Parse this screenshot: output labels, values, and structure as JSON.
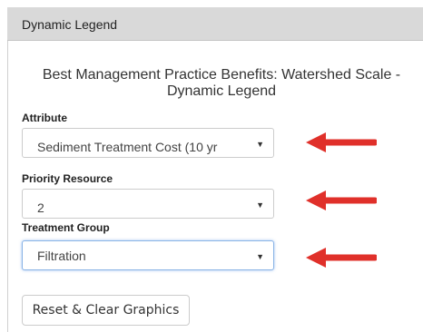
{
  "panel": {
    "title": "Dynamic Legend"
  },
  "legend": {
    "title": "Best Management Practice Benefits: Watershed Scale - Dynamic Legend"
  },
  "fields": {
    "attribute": {
      "label": "Attribute",
      "value": "Sediment Treatment Cost (10 yr"
    },
    "priority_resource": {
      "label": "Priority Resource",
      "value": "2"
    },
    "treatment_group": {
      "label": "Treatment Group",
      "value": "Filtration"
    }
  },
  "buttons": {
    "reset_label": "Reset & Clear Graphics"
  },
  "icons": {
    "dropdown": "chevron-down-icon",
    "annotation": "red-arrow-icon"
  },
  "colors": {
    "arrow": "#e0302a",
    "header_bg": "#d9d9d9",
    "focus_border": "#8ab4e6"
  }
}
